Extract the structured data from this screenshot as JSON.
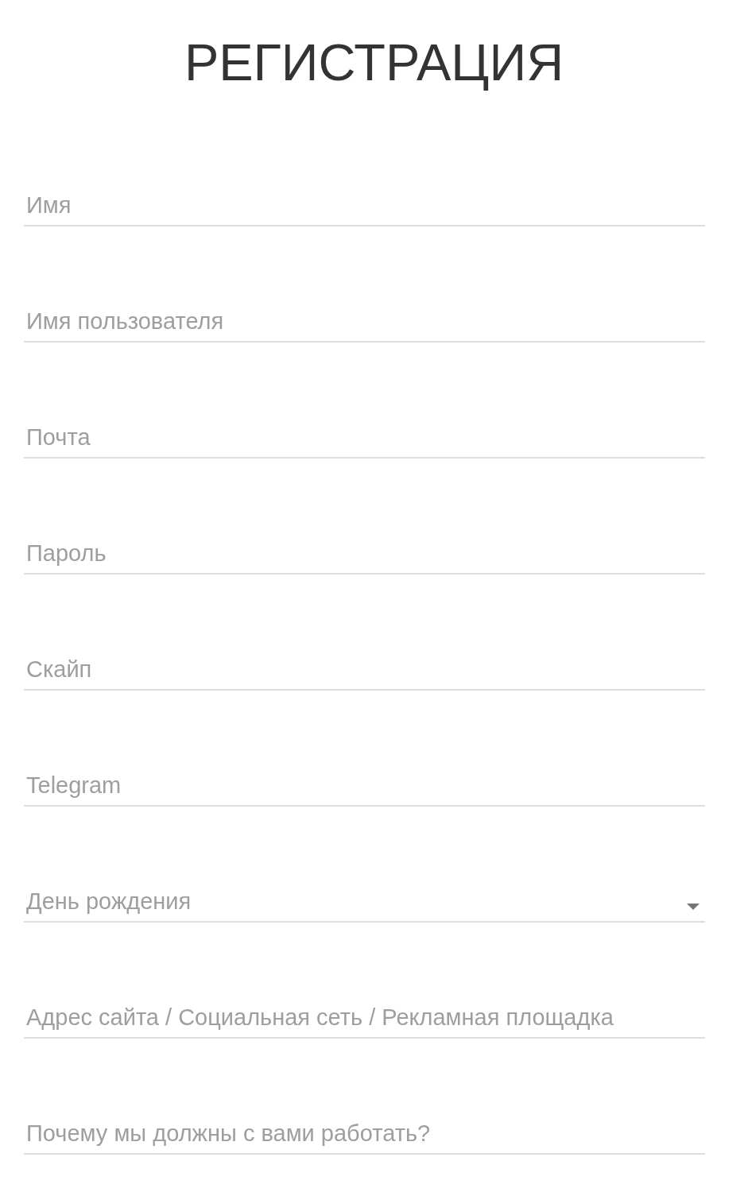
{
  "title": "РЕГИСТРАЦИЯ",
  "fields": [
    {
      "kind": "text",
      "placeholder": "Имя"
    },
    {
      "kind": "text",
      "placeholder": "Имя пользователя"
    },
    {
      "kind": "text",
      "placeholder": "Почта"
    },
    {
      "kind": "text",
      "placeholder": "Пароль"
    },
    {
      "kind": "text",
      "placeholder": "Скайп"
    },
    {
      "kind": "text",
      "placeholder": "Telegram"
    },
    {
      "kind": "select",
      "placeholder": "День рождения"
    },
    {
      "kind": "text",
      "placeholder": "Адрес сайта / Социальная сеть / Рекламная площадка"
    },
    {
      "kind": "text",
      "placeholder": "Почему мы должны с вами работать?"
    }
  ]
}
